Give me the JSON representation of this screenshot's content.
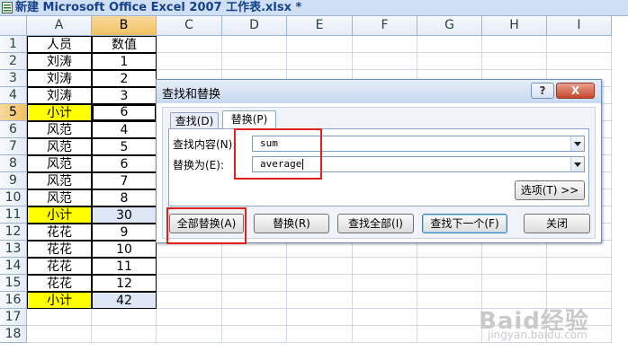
{
  "window": {
    "title": "新建 Microsoft Office Excel 2007 工作表.xlsx *"
  },
  "sheet": {
    "columns": [
      "A",
      "B",
      "C",
      "D",
      "E",
      "F",
      "G",
      "H",
      "I"
    ],
    "rows": [
      "1",
      "2",
      "3",
      "4",
      "5",
      "6",
      "7",
      "8",
      "9",
      "10",
      "11",
      "12",
      "13",
      "14",
      "15",
      "16",
      "17",
      "18"
    ],
    "cells": {
      "A": [
        "人员",
        "刘涛",
        "刘涛",
        "刘涛",
        "小计",
        "风范",
        "风范",
        "风范",
        "风范",
        "风范",
        "小计",
        "花花",
        "花花",
        "花花",
        "花花",
        "小计",
        "",
        ""
      ],
      "B": [
        "数值",
        "1",
        "2",
        "3",
        "6",
        "4",
        "5",
        "6",
        "7",
        "8",
        "30",
        "9",
        "10",
        "11",
        "12",
        "42",
        "",
        ""
      ]
    },
    "active_cell": "B5",
    "highlight_color": "#ffff00"
  },
  "dialog": {
    "title": "查找和替换",
    "help_label": "?",
    "close_label": "X",
    "tabs": [
      {
        "label": "查找(D)",
        "active": false
      },
      {
        "label": "替换(P)",
        "active": true
      }
    ],
    "find_label": "查找内容(N):",
    "find_value": "sum",
    "replace_label": "替换为(E):",
    "replace_value": "average",
    "options_label": "选项(T) >>",
    "buttons": {
      "replace_all": "全部替换(A)",
      "replace": "替换(R)",
      "find_all": "查找全部(I)",
      "find_next": "查找下一个(F)",
      "close": "关闭"
    }
  },
  "annotation_color": "#e3211c",
  "watermark": {
    "main": "Baid经验",
    "sub": "jingyan.baidu.com"
  }
}
